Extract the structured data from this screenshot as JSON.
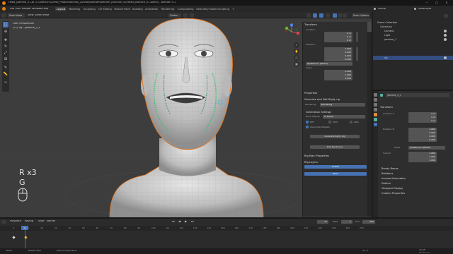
{
  "titlebar": {
    "title": "Head_jasmine_01.jb (C:\\Users\\YU\\Drive_Production\\Maj_Course\\Blender\\Blender_practice_01\\Head_practice_01.blend) - Blender 4.1"
  },
  "menubar": {
    "menus": [
      "File",
      "Edit",
      "Render",
      "Window",
      "Help"
    ],
    "workspaces": [
      "Layout",
      "Modeling",
      "Sculpting",
      "UV Editing",
      "Texture Paint",
      "Shading",
      "Animation",
      "Rendering",
      "Compositing",
      "Geometry Nodes",
      "Scripting"
    ],
    "active_workspace": "Layout",
    "scene_label": "Scene",
    "viewlayer_label": "ViewLayer"
  },
  "viewport_header": {
    "mode": "Pose Mode",
    "menus": [
      "View",
      "Select",
      "Pose"
    ],
    "transform": "Global",
    "pose_options": "Pose Options"
  },
  "viewport": {
    "view_name": "User Perspective",
    "object_info": "(11) rig : jasmine_2_L",
    "keylog_line1": "R x3",
    "keylog_line2": "G"
  },
  "npanel": {
    "tabs": [
      "Item",
      "Tool",
      "View",
      "Animation",
      "Rigify"
    ],
    "transform_title": "Transform",
    "location_label": "Location:",
    "location": [
      "0 m",
      "0 m",
      "0 m"
    ],
    "rotation_label": "Rotation:",
    "rotation": [
      "1.000",
      "0.000",
      "0.000",
      "0.000"
    ],
    "rotation_mode": "Quaternion (WXYZ)",
    "scale_label": "Scale:",
    "scale": [
      "1.000",
      "1.000",
      "1.000"
    ],
    "properties_title": "Properties",
    "generate_title": "Generate and Edit Rigify rig",
    "rig_type": "Rendering",
    "generation_settings": "Generation Settings",
    "bone_display_label": "Bone Display:",
    "bone_display_value": "In Scene",
    "layers_cb": [
      "DEF",
      "MCH",
      "ORG"
    ],
    "overwrite_widgets": "Overwrite Widgets",
    "generate_button": "Generate Rigify Rig",
    "edit_button": "Edit Rendering",
    "rig_main_props": "Rig Main Properties",
    "rig_layers": "Rig Layers",
    "rig_layer_buttons": [
      "Rotate",
      "Move"
    ]
  },
  "outliner": {
    "header": "Scene",
    "rows": [
      "Scene Collection",
      "Collection",
      "Camera",
      "Light",
      "jasmine_1",
      "rig"
    ],
    "selected_index": 5
  },
  "properties": {
    "bone_name": "jasmine_2_L",
    "transform_title": "Transform",
    "location_label": "Location X",
    "location": [
      "0 m",
      "0 m",
      "0 m"
    ],
    "rotation_label": "Rotation W",
    "rotation": [
      "1.000",
      "0.000",
      "0.000",
      "0.000"
    ],
    "mode_label": "Mode",
    "mode_value": "Quaternion (WXYZ)",
    "scale_label": "Scale X",
    "scale": [
      "1.000",
      "1.000",
      "1.000"
    ],
    "sections": [
      "Bendy Bones",
      "Relations",
      "Inverse Kinematics",
      "Deform",
      "Viewport Display",
      "Custom Properties"
    ]
  },
  "timeline": {
    "menus": [
      "Playback",
      "Keying",
      "View",
      "Marker"
    ],
    "current_frame": "11",
    "start_label": "Start",
    "start": "1",
    "end_label": "End",
    "end": "250",
    "frames": [
      "0",
      "10",
      "20",
      "30",
      "40",
      "50",
      "60",
      "70",
      "80",
      "90",
      "100",
      "110",
      "120",
      "130",
      "140",
      "150",
      "160",
      "170",
      "180",
      "190",
      "200",
      "210",
      "220",
      "230",
      "240",
      "250"
    ]
  },
  "statusbar": {
    "items": [
      "Select",
      "Rotate View",
      "Pose Context Menu"
    ],
    "version": "4.1.0",
    "time": "10:05",
    "date": "2024/01/14"
  }
}
